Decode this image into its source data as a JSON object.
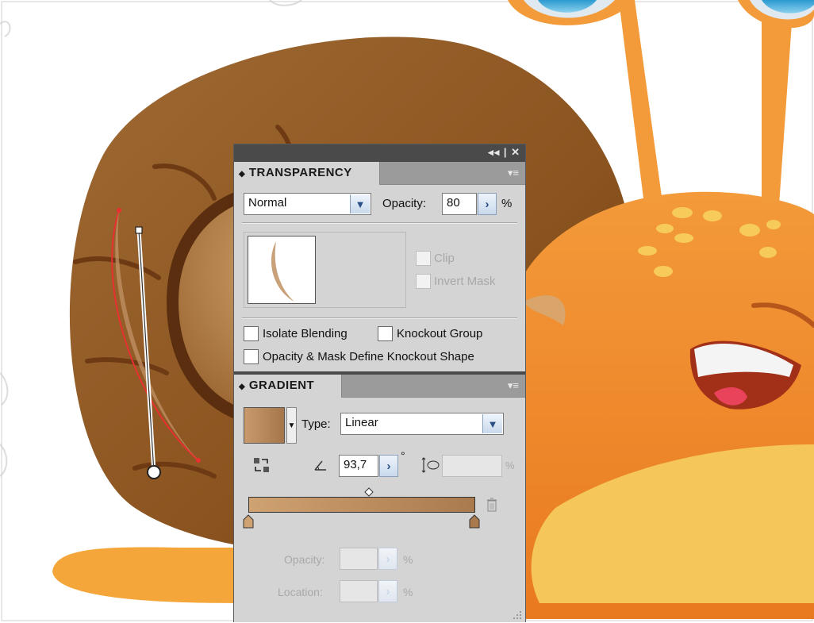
{
  "colors": {
    "panel_bg": "#d4d4d4",
    "titlebar": "#4a4a4a",
    "shell_dark": "#8a531f",
    "shell_light": "#b07a45",
    "snail_body": "#f08a2c",
    "snail_belly": "#f5c75a",
    "gradient_start": "#cfa272",
    "gradient_end": "#a97a4d",
    "path_red": "#e83030"
  },
  "titlebar": {
    "icons": "◂◂ | ✕"
  },
  "transparency": {
    "tab_label": "TRANSPARENCY",
    "tab_glyph": "◆",
    "menu_icon": "▾≡",
    "blend_mode": "Normal",
    "opacity_label": "Opacity:",
    "opacity_value": "80",
    "percent": "%",
    "clip_label": "Clip",
    "invert_mask_label": "Invert Mask",
    "isolate_blending_label": "Isolate Blending",
    "knockout_group_label": "Knockout Group",
    "opacity_mask_label": "Opacity & Mask Define Knockout Shape"
  },
  "gradient": {
    "tab_label": "GRADIENT",
    "tab_glyph": "◆",
    "menu_icon": "▾≡",
    "type_label": "Type:",
    "type_value": "Linear",
    "angle_value": "93,7",
    "degree": "°",
    "aspect_percent": "%",
    "stop_opacity_label": "Opacity:",
    "stop_location_label": "Location:",
    "percent": "%"
  }
}
